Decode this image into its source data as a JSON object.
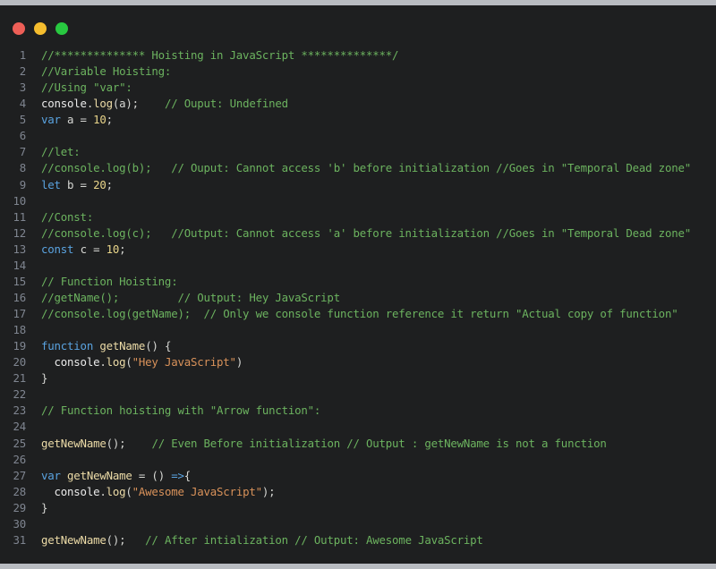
{
  "window": {
    "buttons": [
      {
        "name": "close",
        "color": "#ee5f57"
      },
      {
        "name": "minimize",
        "color": "#f5bd2e"
      },
      {
        "name": "maximize",
        "color": "#28c840"
      }
    ]
  },
  "colors": {
    "background": "#1e1f20",
    "comment": "#6cb35f",
    "keyword": "#5aa3e0",
    "number": "#e9d58a",
    "string": "#d9925a",
    "function": "#ecdba7"
  },
  "code_lines": [
    {
      "n": "1",
      "tokens": [
        {
          "t": "//************** Hoisting in JavaScript **************/",
          "c": "com"
        }
      ]
    },
    {
      "n": "2",
      "tokens": [
        {
          "t": "//Variable Hoisting:",
          "c": "com"
        }
      ]
    },
    {
      "n": "3",
      "tokens": [
        {
          "t": "//Using \"var\":",
          "c": "com"
        }
      ]
    },
    {
      "n": "4",
      "tokens": [
        {
          "t": "console",
          "c": "var"
        },
        {
          "t": ".",
          "c": "pun"
        },
        {
          "t": "log",
          "c": "fn"
        },
        {
          "t": "(a);    ",
          "c": "pun"
        },
        {
          "t": "// Ouput: Undefined",
          "c": "com"
        }
      ]
    },
    {
      "n": "5",
      "tokens": [
        {
          "t": "var",
          "c": "kw"
        },
        {
          "t": " a = ",
          "c": "pun"
        },
        {
          "t": "10",
          "c": "num"
        },
        {
          "t": ";",
          "c": "pun"
        }
      ]
    },
    {
      "n": "6",
      "tokens": []
    },
    {
      "n": "7",
      "tokens": [
        {
          "t": "//let:",
          "c": "com"
        }
      ]
    },
    {
      "n": "8",
      "tokens": [
        {
          "t": "//console.log(b);   // Ouput: Cannot access 'b' before initialization //Goes in \"Temporal Dead zone\"",
          "c": "com"
        }
      ]
    },
    {
      "n": "9",
      "tokens": [
        {
          "t": "let",
          "c": "kw"
        },
        {
          "t": " b = ",
          "c": "pun"
        },
        {
          "t": "20",
          "c": "num"
        },
        {
          "t": ";",
          "c": "pun"
        }
      ]
    },
    {
      "n": "10",
      "tokens": []
    },
    {
      "n": "11",
      "tokens": [
        {
          "t": "//Const:",
          "c": "com"
        }
      ]
    },
    {
      "n": "12",
      "tokens": [
        {
          "t": "//console.log(c);   //Output: Cannot access 'a' before initialization //Goes in \"Temporal Dead zone\"",
          "c": "com"
        }
      ]
    },
    {
      "n": "13",
      "tokens": [
        {
          "t": "const",
          "c": "kw"
        },
        {
          "t": " c = ",
          "c": "pun"
        },
        {
          "t": "10",
          "c": "num"
        },
        {
          "t": ";",
          "c": "pun"
        }
      ]
    },
    {
      "n": "14",
      "tokens": []
    },
    {
      "n": "15",
      "tokens": [
        {
          "t": "// Function Hoisting:",
          "c": "com"
        }
      ]
    },
    {
      "n": "16",
      "tokens": [
        {
          "t": "//getName();         // Output: Hey JavaScript",
          "c": "com"
        }
      ]
    },
    {
      "n": "17",
      "tokens": [
        {
          "t": "//console.log(getName);  // Only we console function reference it return \"Actual copy of function\"",
          "c": "com"
        }
      ]
    },
    {
      "n": "18",
      "tokens": []
    },
    {
      "n": "19",
      "tokens": [
        {
          "t": "function",
          "c": "kw"
        },
        {
          "t": " ",
          "c": "pun"
        },
        {
          "t": "getName",
          "c": "fn"
        },
        {
          "t": "() {",
          "c": "pun"
        }
      ]
    },
    {
      "n": "20",
      "tokens": [
        {
          "t": "  console",
          "c": "var"
        },
        {
          "t": ".",
          "c": "pun"
        },
        {
          "t": "log",
          "c": "fn"
        },
        {
          "t": "(",
          "c": "pun"
        },
        {
          "t": "\"Hey JavaScript\"",
          "c": "str"
        },
        {
          "t": ")",
          "c": "pun"
        }
      ]
    },
    {
      "n": "21",
      "tokens": [
        {
          "t": "}",
          "c": "pun"
        }
      ]
    },
    {
      "n": "22",
      "tokens": []
    },
    {
      "n": "23",
      "tokens": [
        {
          "t": "// Function hoisting with \"Arrow function\":",
          "c": "com"
        }
      ]
    },
    {
      "n": "24",
      "tokens": []
    },
    {
      "n": "25",
      "tokens": [
        {
          "t": "getNewName",
          "c": "fn"
        },
        {
          "t": "();    ",
          "c": "pun"
        },
        {
          "t": "// Even Before initialization // Output : getNewName is not a function",
          "c": "com"
        }
      ]
    },
    {
      "n": "26",
      "tokens": []
    },
    {
      "n": "27",
      "tokens": [
        {
          "t": "var",
          "c": "kw"
        },
        {
          "t": " ",
          "c": "pun"
        },
        {
          "t": "getNewName",
          "c": "fn"
        },
        {
          "t": " = () ",
          "c": "pun"
        },
        {
          "t": "=>",
          "c": "kw"
        },
        {
          "t": "{",
          "c": "pun"
        }
      ]
    },
    {
      "n": "28",
      "tokens": [
        {
          "t": "  console",
          "c": "var"
        },
        {
          "t": ".",
          "c": "pun"
        },
        {
          "t": "log",
          "c": "fn"
        },
        {
          "t": "(",
          "c": "pun"
        },
        {
          "t": "\"Awesome JavaScript\"",
          "c": "str"
        },
        {
          "t": ");",
          "c": "pun"
        }
      ]
    },
    {
      "n": "29",
      "tokens": [
        {
          "t": "}",
          "c": "pun"
        }
      ]
    },
    {
      "n": "30",
      "tokens": []
    },
    {
      "n": "31",
      "tokens": [
        {
          "t": "getNewName",
          "c": "fn"
        },
        {
          "t": "();   ",
          "c": "pun"
        },
        {
          "t": "// After intialization // Output: Awesome JavaScript",
          "c": "com"
        }
      ]
    }
  ]
}
